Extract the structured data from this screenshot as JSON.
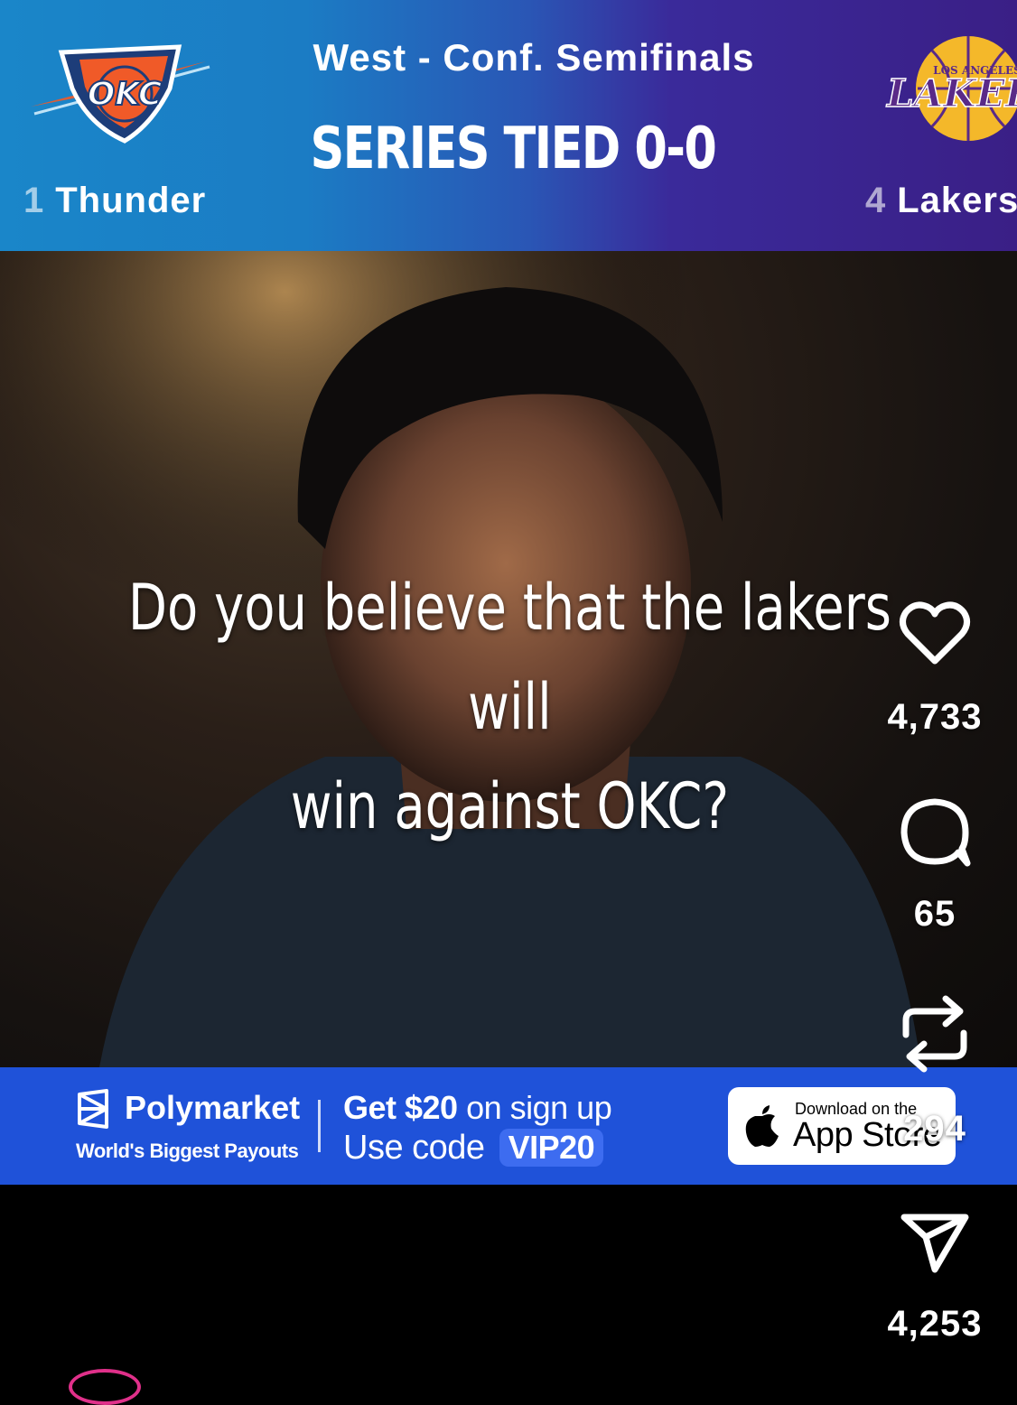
{
  "header": {
    "round_title": "West - Conf. Semifinals",
    "series_status": "SERIES TIED 0-0",
    "left_team": {
      "seed": "1",
      "name": "Thunder",
      "logo_text": "OKC"
    },
    "right_team": {
      "seed": "4",
      "name": "Lakers",
      "logo_text": "LAKERS",
      "logo_subtext": "LOS ANGELES"
    }
  },
  "video": {
    "caption_line1": "Do you believe that the lakers will",
    "caption_line2": "win against  OKC?"
  },
  "actions": {
    "likes": "4,733",
    "comments": "65",
    "reposts": "294",
    "shares": "4,253"
  },
  "ad": {
    "brand": "Polymarket",
    "tagline": "World's Biggest Payouts",
    "offer_bold": "Get $20",
    "offer_rest": " on sign up",
    "code_prefix": "Use code ",
    "code": "VIP20",
    "appstore_small": "Download on the",
    "appstore_big": "App Store"
  },
  "colors": {
    "ad_blue": "#1f52d9",
    "thunder_blue": "#1a86c9",
    "lakers_purple": "#3a1f86",
    "lakers_gold": "#f4b82a"
  }
}
